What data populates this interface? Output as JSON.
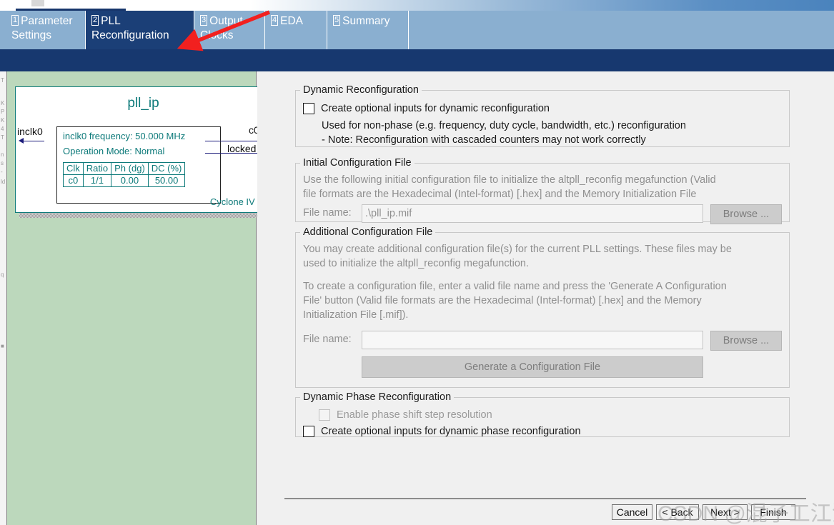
{
  "window": {
    "accent_navy": "#17386f",
    "accent_tab_blue": "#8aafd0",
    "panel_green": "#bcd8bc",
    "symbol_teal": "#0d7a7a"
  },
  "tabs": [
    {
      "num": "1",
      "label": "Parameter Settings",
      "active": false
    },
    {
      "num": "2",
      "label": "PLL Reconfiguration",
      "active": true
    },
    {
      "num": "3",
      "label": "Output Clocks",
      "active": false
    },
    {
      "num": "4",
      "label": "EDA",
      "active": false
    },
    {
      "num": "5",
      "label": "Summary",
      "active": false
    }
  ],
  "preview": {
    "title": "pll_ip",
    "device_family": "Cyclone IV E",
    "info_lines": [
      "inclk0 frequency: 50.000 MHz",
      "Operation Mode: Normal"
    ],
    "ports": {
      "input": "inclk0",
      "output_c0": "c0",
      "output_locked": "locked"
    },
    "clock_table": {
      "headers": [
        "Clk",
        "Ratio",
        "Ph (dg)",
        "DC (%)"
      ],
      "rows": [
        [
          "c0",
          "1/1",
          "0.00",
          "50.00"
        ]
      ]
    }
  },
  "dynamic_reconfiguration": {
    "legend": "Dynamic Reconfiguration",
    "checkbox_label": "Create optional inputs for dynamic reconfiguration",
    "checkbox_checked": false,
    "note_line1": "Used for non-phase (e.g. frequency, duty cycle, bandwidth, etc.) reconfiguration",
    "note_line2": "- Note: Reconfiguration with cascaded counters may not work correctly"
  },
  "initial_configuration_file": {
    "legend": "Initial Configuration File",
    "description_line1": "Use the following initial configuration file to initialize the altpll_reconfig megafunction (Valid",
    "description_line2": "file formats are the Hexadecimal (Intel-format) [.hex] and the Memory Initialization File",
    "file_name_label": "File name:",
    "file_name_value": ".\\pll_ip.mif",
    "browse_label": "Browse ..."
  },
  "additional_configuration_file": {
    "legend": "Additional Configuration File",
    "paragraph1_line1": "You may create additional configuration file(s) for the current PLL settings. These files may be",
    "paragraph1_line2": "used to initialize the altpll_reconfig megafunction.",
    "paragraph2_line1": "To create a configuration file, enter a valid file name and press the 'Generate A Configuration",
    "paragraph2_line2": "File' button (Valid file formats are the Hexadecimal (Intel-format) [.hex] and the Memory",
    "paragraph2_line3": "Initialization File [.mif]).",
    "file_name_label": "File name:",
    "file_name_value": "",
    "file_name_placeholder": "",
    "browse_label": "Browse ...",
    "generate_label": "Generate a Configuration File"
  },
  "dynamic_phase_reconfiguration": {
    "legend": "Dynamic Phase Reconfiguration",
    "enable_step_label": "Enable phase shift step resolution",
    "enable_step_checked": false,
    "enable_step_disabled": true,
    "create_inputs_label": "Create optional inputs for dynamic phase reconfiguration",
    "create_inputs_checked": false
  },
  "footer": {
    "cancel": "Cancel",
    "back": "< Back",
    "next": "Next >",
    "finish": "Finish"
  },
  "overlay": {
    "watermark": "CSDN @混子工江江"
  }
}
